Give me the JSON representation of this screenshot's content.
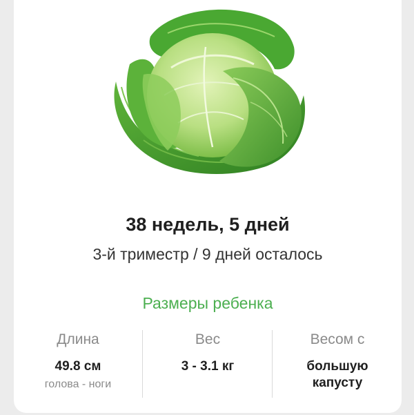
{
  "week": {
    "title": "38 недель, 5 дней",
    "subtitle": "3-й триместр / 9 дней осталось"
  },
  "baby_size": {
    "section_title": "Размеры ребенка",
    "length": {
      "label": "Длина",
      "value": "49.8 см",
      "note": "голова - ноги"
    },
    "weight": {
      "label": "Вес",
      "value": "3 - 3.1 кг"
    },
    "comparison": {
      "label": "Весом с",
      "value_line1": "большую",
      "value_line2": "капусту"
    }
  },
  "illustration": {
    "subject": "cabbage",
    "colors": {
      "outer_leaf": "#3f9a2e",
      "inner_leaf": "#9fd36b",
      "head": "#c6e68f",
      "vein": "#e8f5cf"
    }
  },
  "colors": {
    "accent": "#4caf50",
    "text_primary": "#1f1f1f",
    "text_secondary": "#8a8a8a",
    "background": "#ececec",
    "card": "#ffffff"
  }
}
